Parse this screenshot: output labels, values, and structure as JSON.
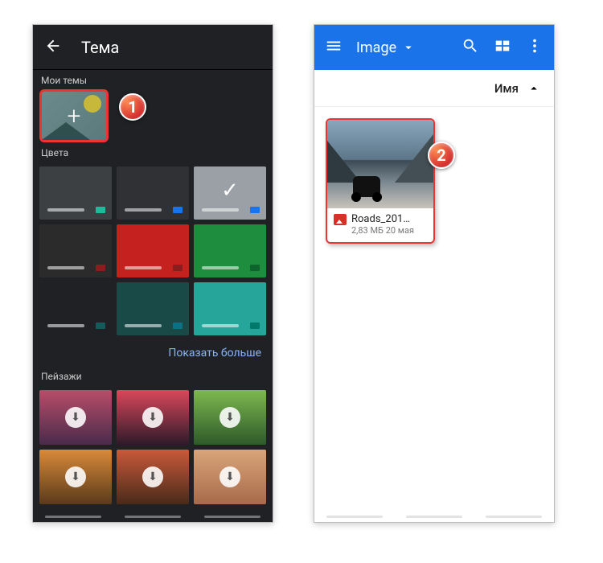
{
  "left": {
    "screen_title": "Тема",
    "my_themes_label": "Мои темы",
    "colors_label": "Цвета",
    "show_more": "Показать больше",
    "landscapes_label": "Пейзажи",
    "callout": "1",
    "color_tiles": [
      {
        "bg": "#3c4043",
        "chip": "#1abc9c"
      },
      {
        "bg": "#303134",
        "chip": "#1a73e8"
      },
      {
        "bg": "#9aa0a6",
        "chip": "#1a73e8",
        "selected": true
      },
      {
        "bg": "#2b2b2b",
        "chip": "#8a1d1d"
      },
      {
        "bg": "#c5221f",
        "chip": "#8a1d1d"
      },
      {
        "bg": "#1e8e3e",
        "chip": "#0d652d"
      },
      {
        "bg": "#202124",
        "chip": "#145c5c"
      },
      {
        "bg": "#1a4a48",
        "chip": "#0b7285"
      },
      {
        "bg": "#26a69a",
        "chip": "#00796b"
      }
    ],
    "landscapes": [
      {
        "bg": "linear-gradient(180deg,#b84d6a,#4a2b4a)"
      },
      {
        "bg": "linear-gradient(180deg,#d9475a,#2e1a2a)"
      },
      {
        "bg": "linear-gradient(180deg,#7db84f,#2e5a2a)"
      },
      {
        "bg": "linear-gradient(180deg,#d98a3a,#5a3a1a)"
      },
      {
        "bg": "linear-gradient(180deg,#c85a3a,#4a2a1a)"
      },
      {
        "bg": "linear-gradient(180deg,#d9a57a,#a86a4a)"
      }
    ]
  },
  "right": {
    "title": "Image",
    "sort_label": "Имя",
    "file": {
      "name": "Roads_201…",
      "meta": "2,83 МБ 20 мая"
    },
    "callout": "2"
  }
}
